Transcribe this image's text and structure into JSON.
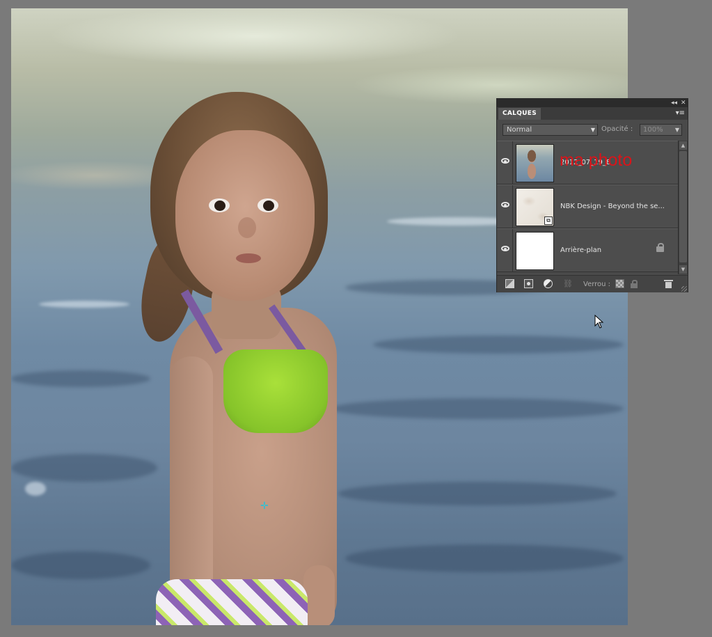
{
  "canvas": {
    "description_icon": "photo-canvas"
  },
  "layers_panel": {
    "tab_label": "CALQUES",
    "titlebar_collapse": "◂◂",
    "titlebar_close": "✕",
    "menu_icon": "▾≡",
    "blend_mode": "Normal",
    "opacity_label": "Opacité :",
    "opacity_value": "100%",
    "lock_label": "Verrou :",
    "layers": [
      {
        "name": "2012_07_19_8",
        "annotation": "ma photo",
        "visible": true,
        "thumbnail": "photo"
      },
      {
        "name": "NBK Design - Beyond the se...",
        "visible": true,
        "thumbnail": "paper-texture",
        "linked": true
      },
      {
        "name": "Arrière-plan",
        "visible": true,
        "thumbnail": "white",
        "locked": true
      }
    ],
    "footer_icons": [
      "new-layer-icon",
      "layer-mask-icon",
      "adjustment-layer-icon",
      "link-icon",
      "lock-transparent-icon",
      "lock-all-icon",
      "trash-icon"
    ]
  },
  "colors": {
    "panel_bg": "#4a4a4a",
    "annotation_red": "#d9141a",
    "workspace_gray": "#7a7a7a"
  }
}
